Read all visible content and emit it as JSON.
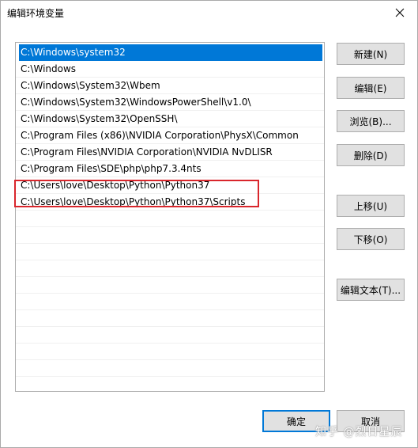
{
  "window": {
    "title": "编辑环境变量"
  },
  "paths": [
    "C:\\Windows\\system32",
    "C:\\Windows",
    "C:\\Windows\\System32\\Wbem",
    "C:\\Windows\\System32\\WindowsPowerShell\\v1.0\\",
    "C:\\Windows\\System32\\OpenSSH\\",
    "C:\\Program Files (x86)\\NVIDIA Corporation\\PhysX\\Common",
    "C:\\Program Files\\NVIDIA Corporation\\NVIDIA NvDLISR",
    "C:\\Program Files\\SDE\\php\\php7.3.4nts",
    "C:\\Users\\love\\Desktop\\Python\\Python37",
    "C:\\Users\\love\\Desktop\\Python\\Python37\\Scripts"
  ],
  "buttons": {
    "new": "新建(N)",
    "edit": "编辑(E)",
    "browse": "浏览(B)...",
    "delete": "删除(D)",
    "up": "上移(U)",
    "down": "下移(O)",
    "edit_text": "编辑文本(T)...",
    "ok": "确定",
    "cancel": "取消"
  },
  "watermark": "知乎 @烈日星辰",
  "colors": {
    "selection": "#0078d7",
    "highlight_box": "#d9262c"
  }
}
